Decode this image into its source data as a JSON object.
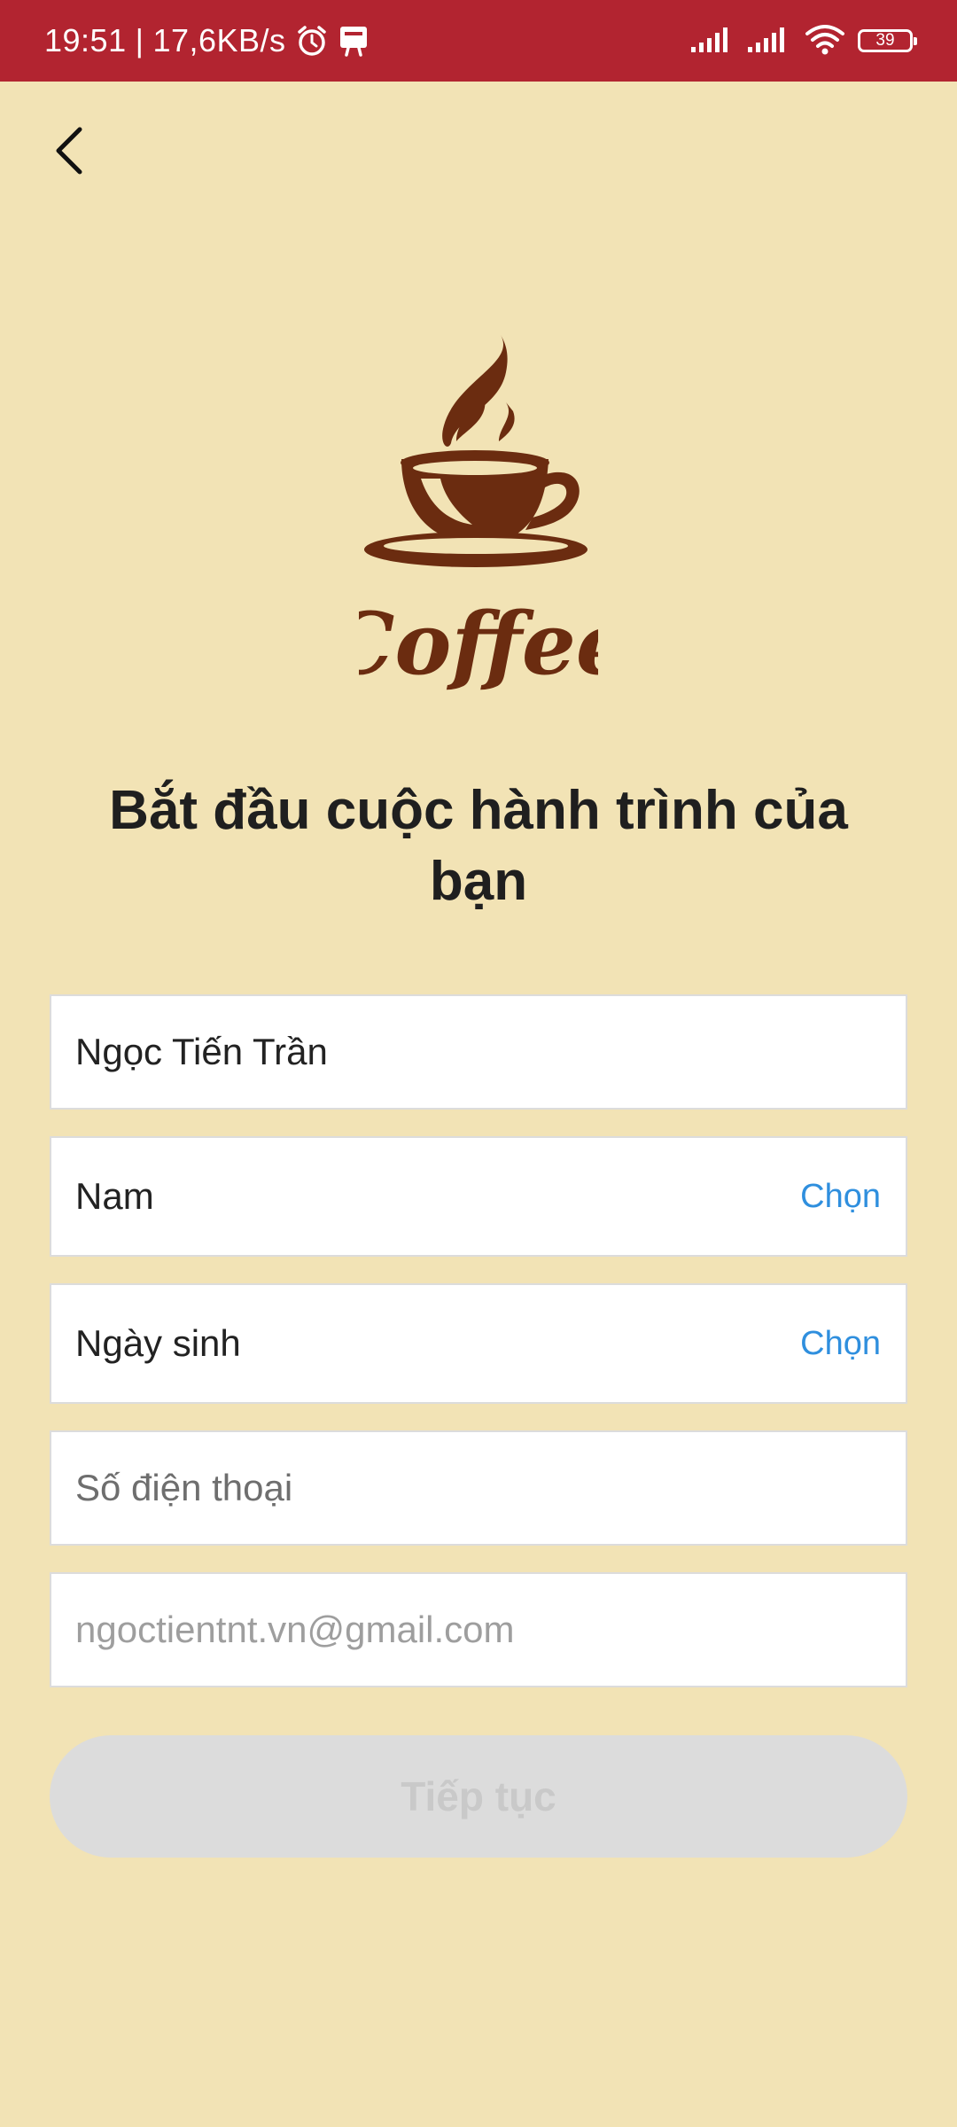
{
  "status_bar": {
    "time": "19:51",
    "separator": "|",
    "network_speed": "17,6KB/s",
    "battery_level": "39",
    "icons": [
      "alarm-icon",
      "notification-icon",
      "signal-icon",
      "signal-icon",
      "wifi-icon",
      "battery-icon"
    ]
  },
  "header": {
    "back_icon": "chevron-left-icon"
  },
  "logo": {
    "text": "Coffee",
    "color": "#6b2c10"
  },
  "title": "Bắt đầu cuộc hành trình của bạn",
  "form": {
    "name_value": "Ngọc Tiến Trần",
    "gender_value": "Nam",
    "gender_action": "Chọn",
    "birthday_label": "Ngày sinh",
    "birthday_action": "Chọn",
    "phone_placeholder": "Số điện thoại",
    "email_placeholder": "ngoctientnt.vn@gmail.com"
  },
  "continue_label": "Tiếp tục",
  "colors": {
    "status_bar": "#b22430",
    "background": "#f2e3b5",
    "accent_link": "#2f8fde",
    "disabled_button": "#dcdcdc"
  }
}
